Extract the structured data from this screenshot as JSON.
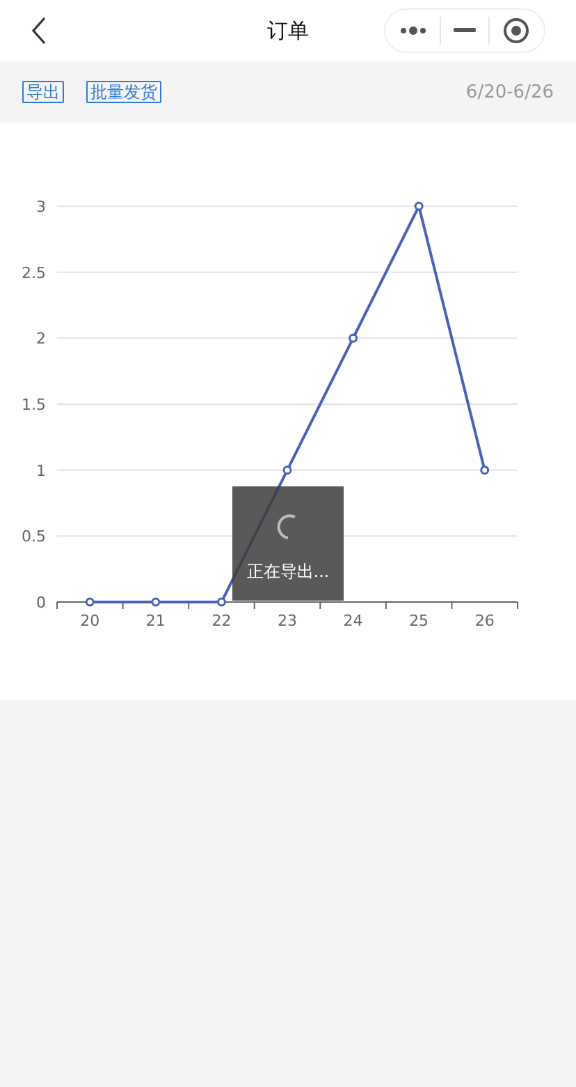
{
  "nav_bar": {
    "title": "订单"
  },
  "toolbar": {
    "buttons": [
      "导出",
      "批量发货"
    ],
    "date_range": "6/20-6/26"
  },
  "chart": {
    "chart_data": {
      "type": "line",
      "categories": [
        "20",
        "21",
        "22",
        "23",
        "24",
        "25",
        "26"
      ],
      "series": [
        {
          "color": "#4a62b8",
          "values": [
            0,
            0,
            0,
            1,
            2,
            3,
            1
          ],
          "marker": true
        }
      ],
      "ylim": [
        0,
        3
      ],
      "yticks": [
        0,
        0.5,
        1,
        1.5,
        2,
        2.5,
        3
      ],
      "grid": true
    }
  },
  "toast": {
    "text": "正在导出..."
  }
}
